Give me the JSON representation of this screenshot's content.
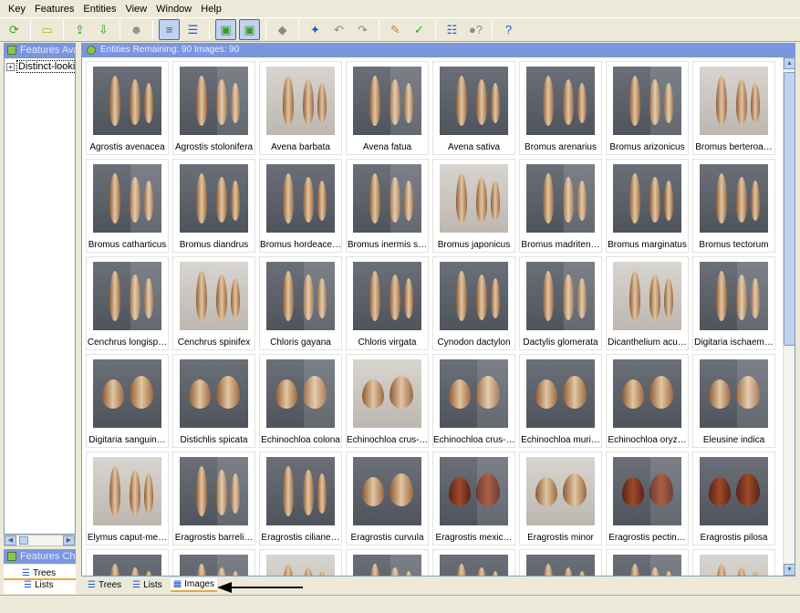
{
  "menu": [
    "Key",
    "Features",
    "Entities",
    "View",
    "Window",
    "Help"
  ],
  "toolbar": [
    {
      "icon": "refresh-icon",
      "glyph": "⟳",
      "color": "green"
    },
    {
      "icon": "open-folder-icon",
      "glyph": "▭",
      "color": "yellow"
    },
    {
      "icon": "export-icon",
      "glyph": "⇪",
      "color": "green"
    },
    {
      "icon": "import-icon",
      "glyph": "⇩",
      "color": "green"
    },
    {
      "icon": "people-icon",
      "glyph": "☻",
      "color": "gray"
    },
    {
      "icon": "list-view-icon",
      "glyph": "≡",
      "color": "blue",
      "active": true
    },
    {
      "icon": "detail-list-icon",
      "glyph": "☰",
      "color": "blue"
    },
    {
      "icon": "image-view-icon",
      "glyph": "▣",
      "color": "green",
      "active": true
    },
    {
      "icon": "image-view-alt-icon",
      "glyph": "▣",
      "color": "green",
      "active": true
    },
    {
      "icon": "tag-icon",
      "glyph": "◆",
      "color": "gray"
    },
    {
      "icon": "wand-icon",
      "glyph": "✦",
      "color": "blue"
    },
    {
      "icon": "back-icon",
      "glyph": "↶",
      "color": "gray"
    },
    {
      "icon": "forward-icon",
      "glyph": "↷",
      "color": "gray"
    },
    {
      "icon": "tools-icon",
      "glyph": "✎",
      "color": "orange"
    },
    {
      "icon": "check-icon",
      "glyph": "✓",
      "color": "green"
    },
    {
      "icon": "checklist-icon",
      "glyph": "☷",
      "color": "blue"
    },
    {
      "icon": "query-icon",
      "glyph": "●?",
      "color": "gray"
    },
    {
      "icon": "help-icon",
      "glyph": "?",
      "color": "blue"
    }
  ],
  "left_panel": {
    "features_header": "Features Ava",
    "tree_node": "Distinct-looki",
    "chosen_header": "Features Cho",
    "tabs": [
      "Trees",
      "Lists"
    ]
  },
  "right_panel": {
    "header": "Entities Remaining: 90 Images: 90",
    "tabs": [
      "Trees",
      "Lists",
      "Images"
    ]
  },
  "entities": [
    "Agrostis avenacea",
    "Agrostis stolonifera",
    "Avena barbata",
    "Avena fatua",
    "Avena sativa",
    "Bromus arenarius",
    "Bromus arizonicus",
    "Bromus berteroa…",
    "Bromus catharticus",
    "Bromus diandrus",
    "Bromus hordeace…",
    "Bromus inermis s…",
    "Bromus japonicus",
    "Bromus madriten…",
    "Bromus marginatus",
    "Bromus tectorum",
    "Cenchrus longisp…",
    "Cenchrus spinifex",
    "Chloris gayana",
    "Chloris virgata",
    "Cynodon dactylon",
    "Dactylis glomerata",
    "Dicanthelium acu…",
    "Digitaria ischaem…",
    "Digitaria sanguin…",
    "Distichlis spicata",
    "Echinochloa colona",
    "Echinochloa crus-…",
    "Echinochloa crus-…",
    "Echinochloa muri…",
    "Echinochloa oryz…",
    "Eleusine indica",
    "Elymus caput-me…",
    "Eragrostis barreli…",
    "Eragrostis ciliane…",
    "Eragrostis curvula",
    "Eragrostis mexic…",
    "Eragrostis minor",
    "Eragrostis pectin…",
    "Eragrostis pilosa",
    "",
    "",
    "",
    "",
    "",
    "",
    "",
    ""
  ]
}
